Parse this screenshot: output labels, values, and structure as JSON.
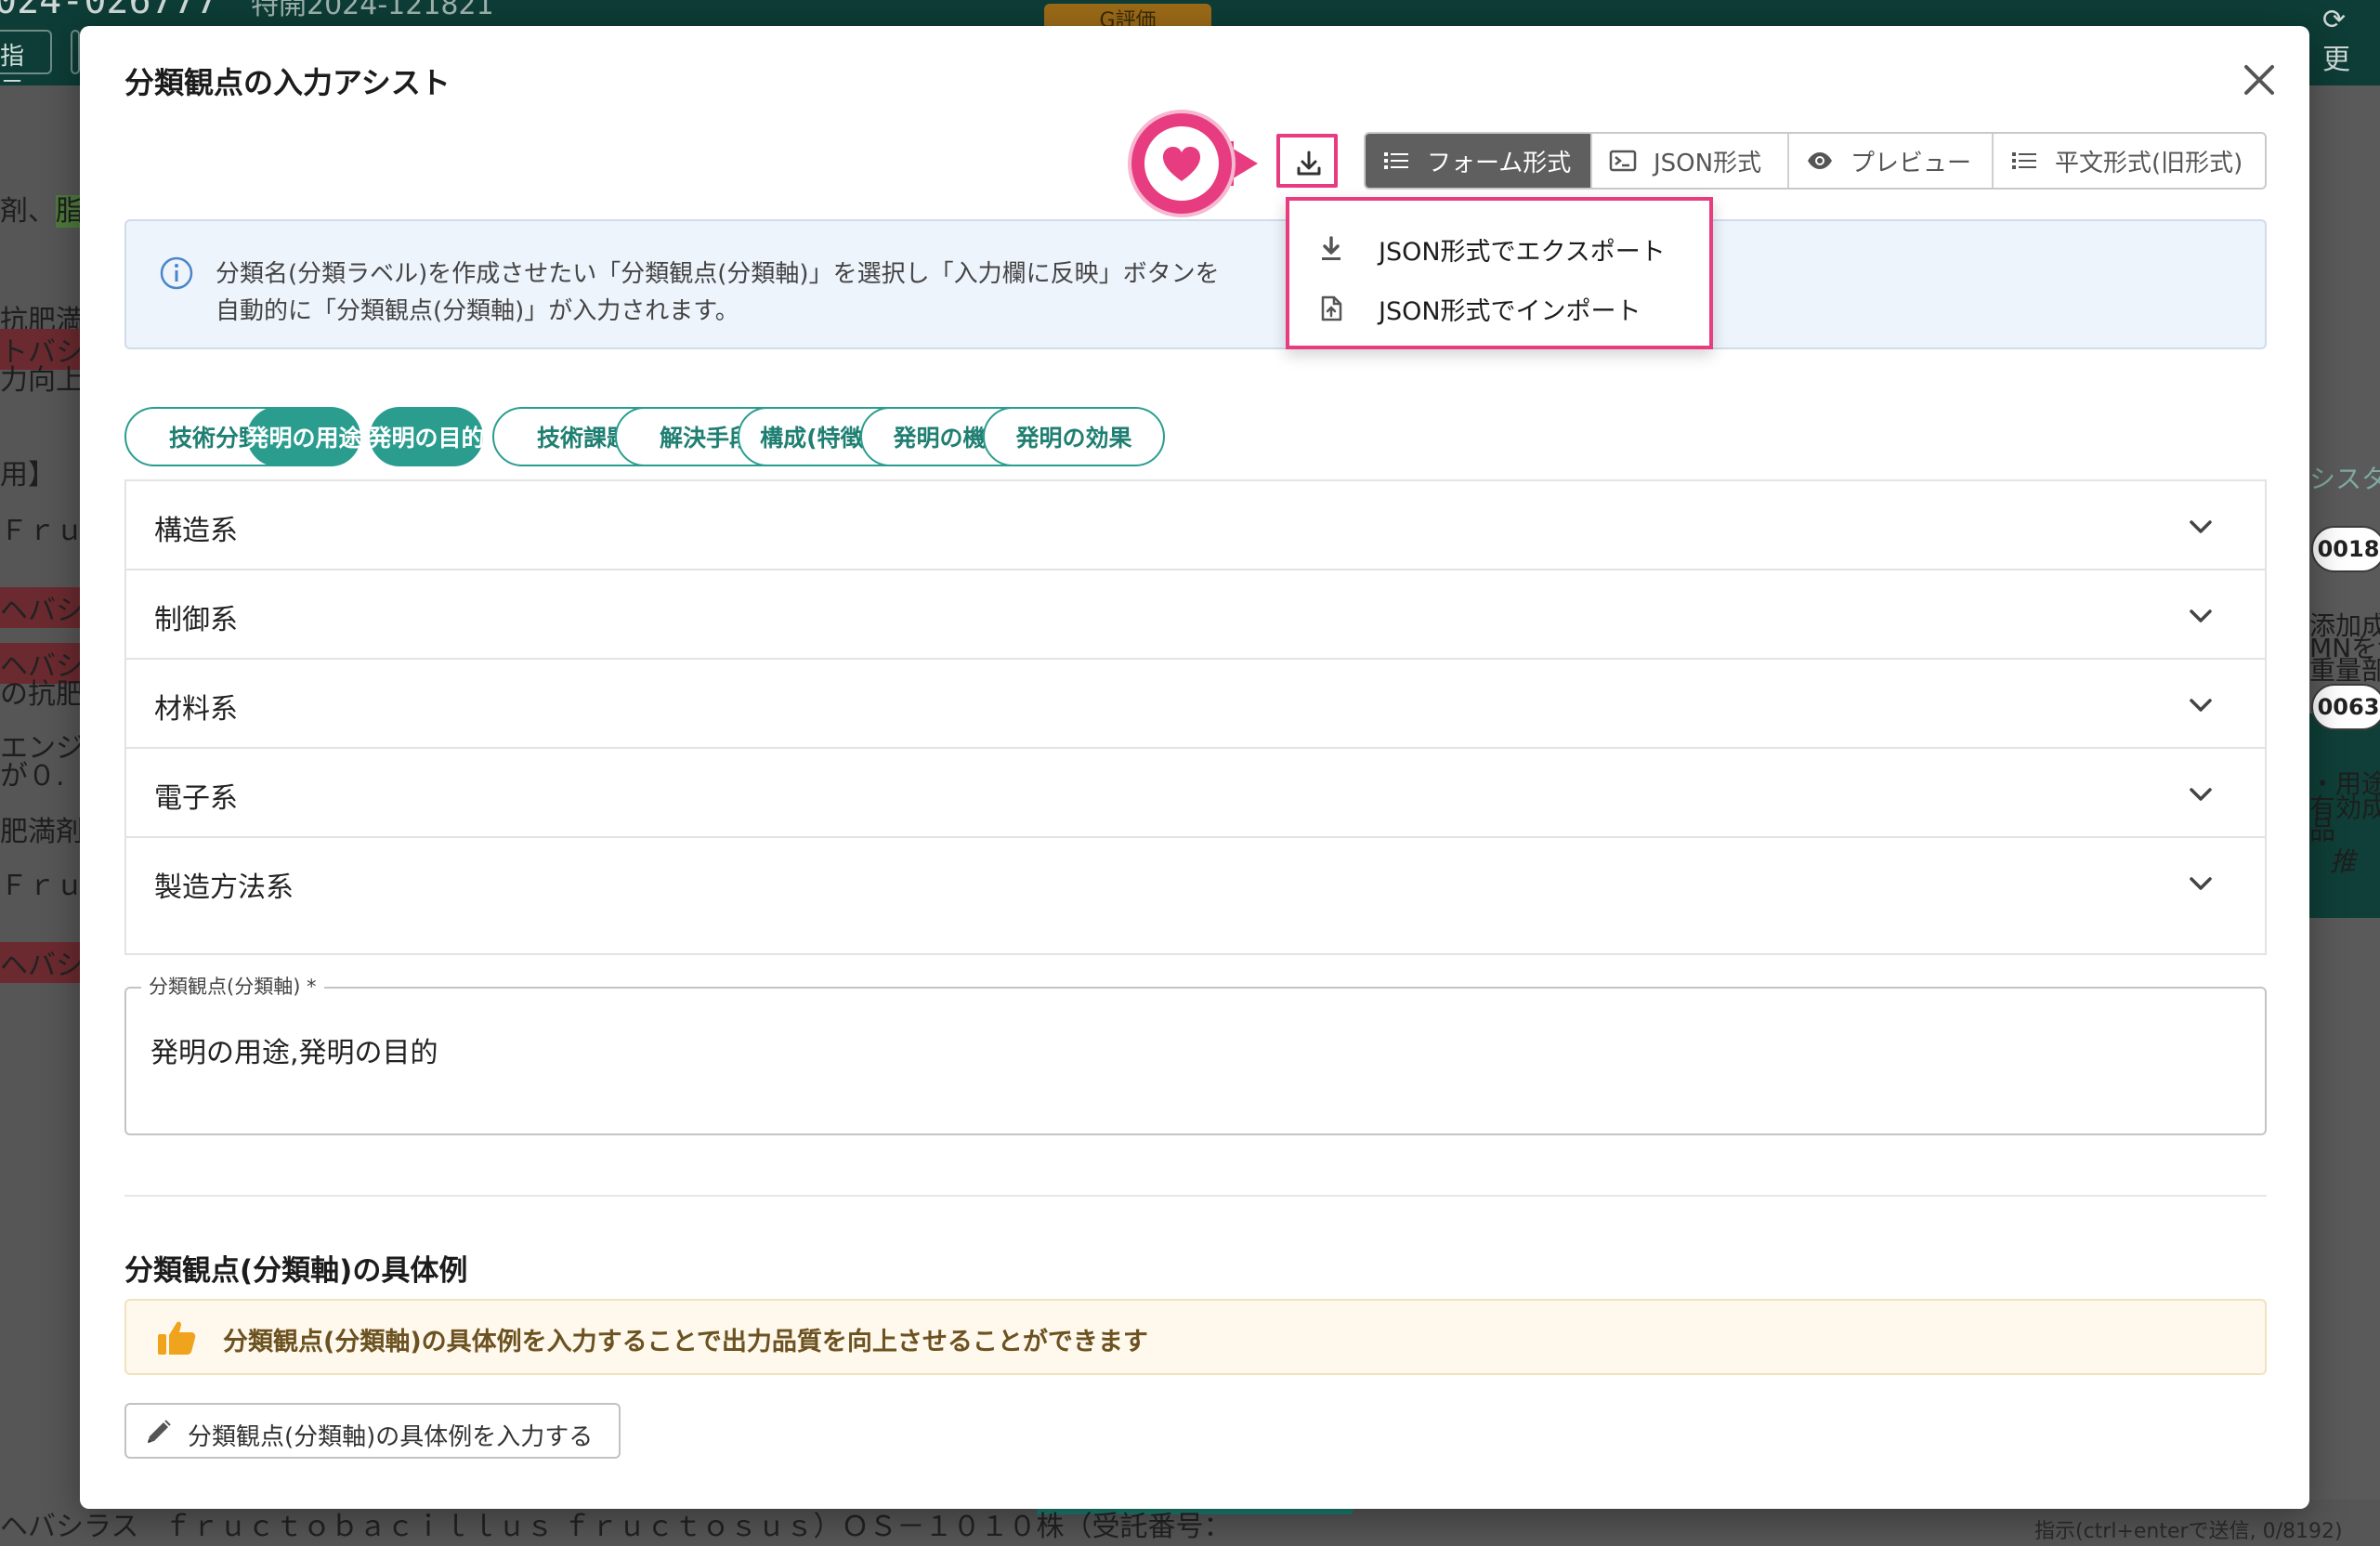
{
  "background": {
    "top_title": "024-026777",
    "top_title2": "特開2024-121821",
    "top_badge": "G評価",
    "top_left_button": "指示",
    "left_lines": [
      "剤、",
      "脂",
      "抗肥満",
      "トバシ",
      "力向上",
      "用】",
      "Ｆｒｕ",
      "ヘバシ",
      "ヘバシ",
      "の抗肥",
      "エンジ",
      "が０.",
      "肥満剤",
      "Ｆｒｕ",
      "ヘバシ"
    ],
    "right_lines": [
      "更",
      "シスタ",
      "0018",
      "添加成",
      "MNを含",
      "重量部",
      "0063",
      "・用途",
      "有効成",
      "品",
      "推"
    ],
    "bottom_text": "ヘバシラス",
    "bottom_text2": "ｆｒｕｃｔｏｂａｃｉｌｌｕｓ ｆｒｕｃｔｏｓｕｓ）ＯＳ－１０１０株（受託番号：",
    "bottom_hint": "指示(ctrl+enterで送信, 0/8192)"
  },
  "modal": {
    "title": "分類観点の入力アシスト",
    "close_icon": "close-icon"
  },
  "toolbar": {
    "download_icon": "download-icon",
    "tabs": [
      {
        "label": "フォーム形式",
        "icon": "list-icon",
        "active": true
      },
      {
        "label": "JSON形式",
        "icon": "terminal-icon",
        "active": false
      },
      {
        "label": "プレビュー",
        "icon": "eye-icon",
        "active": false
      },
      {
        "label": "平文形式(旧形式)",
        "icon": "list-icon",
        "active": false
      }
    ]
  },
  "dropdown": {
    "items": [
      {
        "label": "JSON形式でエクスポート",
        "icon": "download-icon"
      },
      {
        "label": "JSON形式でインポート",
        "icon": "file-upload-icon"
      }
    ]
  },
  "info": {
    "line1": "分類名(分類ラベル)を作成させたい「分類観点(分類軸)」を選択し「入力欄に反映」ボタンを",
    "line2": "自動的に「分類観点(分類軸)」が入力されます。"
  },
  "chips": [
    {
      "label": "技術分野",
      "selected": false
    },
    {
      "label": "発明の用途",
      "selected": true
    },
    {
      "label": "発明の目的",
      "selected": true
    },
    {
      "label": "技術課題",
      "selected": false
    },
    {
      "label": "解決手段",
      "selected": false
    },
    {
      "label": "構成(特徴部)",
      "selected": false
    },
    {
      "label": "発明の機能",
      "selected": false
    },
    {
      "label": "発明の効果",
      "selected": false
    }
  ],
  "accordion": [
    {
      "label": "構造系"
    },
    {
      "label": "制御系"
    },
    {
      "label": "材料系"
    },
    {
      "label": "電子系"
    },
    {
      "label": "製造方法系"
    }
  ],
  "field": {
    "label": "分類観点(分類軸) *",
    "value": "発明の用途,発明の目的"
  },
  "examples": {
    "title": "分類観点(分類軸)の具体例",
    "tip": "分類観点(分類軸)の具体例を入力することで出力品質を向上させることができます",
    "button": "分類観点(分類軸)の具体例を入力する"
  },
  "colors": {
    "accent": "#2a9d8f",
    "highlight": "#e73c80",
    "active_tab": "#5f5f5f"
  }
}
